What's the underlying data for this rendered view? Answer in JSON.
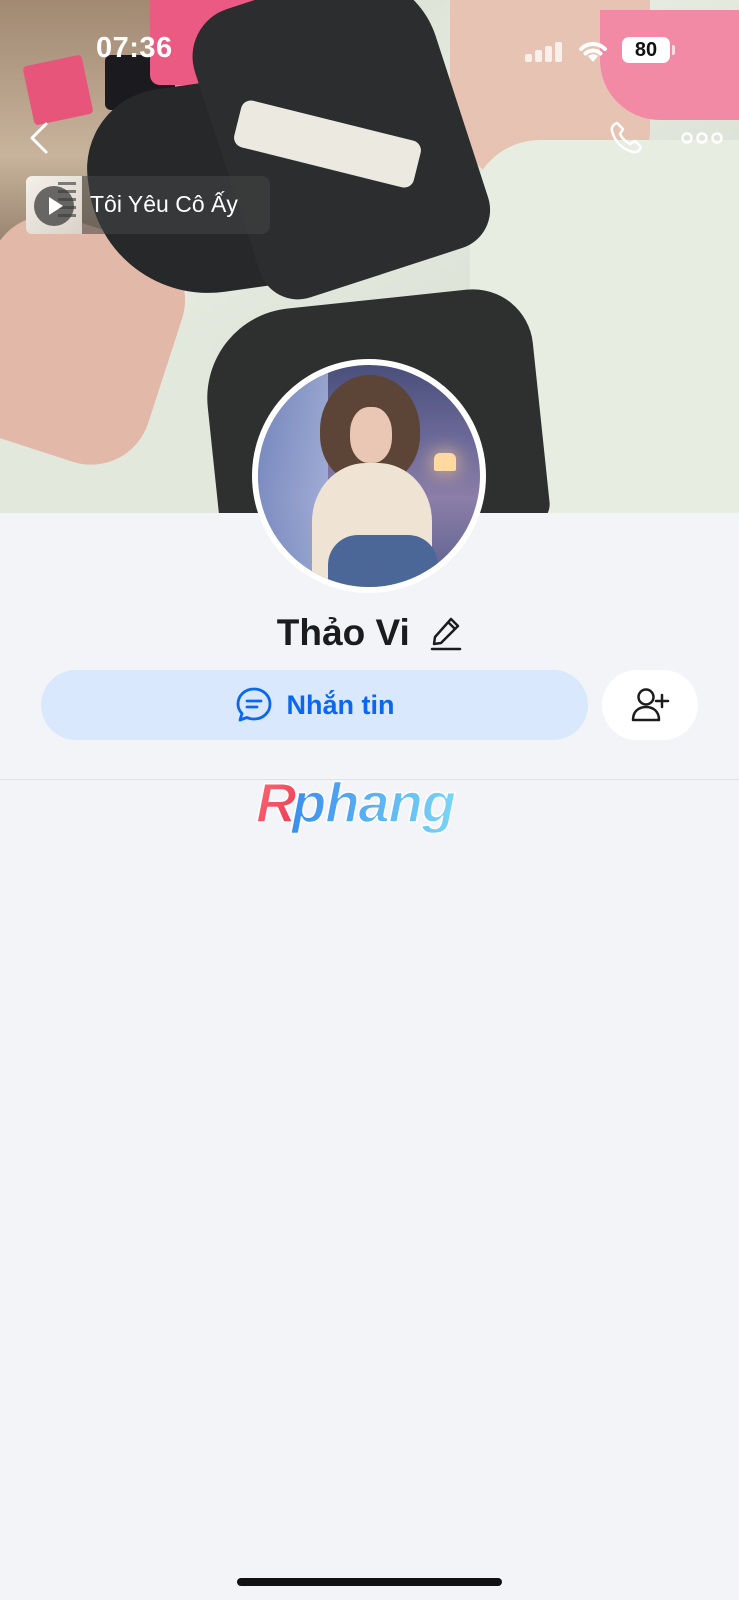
{
  "status_bar": {
    "time": "07:36",
    "battery": "80",
    "icons": [
      "signal-icon",
      "wifi-icon",
      "battery-icon"
    ]
  },
  "nav": {
    "icons": [
      "back-icon",
      "phone-icon",
      "more-icon"
    ]
  },
  "music": {
    "title": "Tôi Yêu Cô Ấy",
    "icon": "play-icon"
  },
  "profile": {
    "name": "Thảo Vi",
    "edit_icon": "pencil-icon"
  },
  "actions": {
    "message_label": "Nhắn tin",
    "message_icon": "chat-bubble-icon",
    "add_friend_icon": "add-user-icon",
    "accent_color": "#0a68f0",
    "message_bg": "#d9e8fd"
  },
  "watermark": {
    "text": "Rphang"
  }
}
